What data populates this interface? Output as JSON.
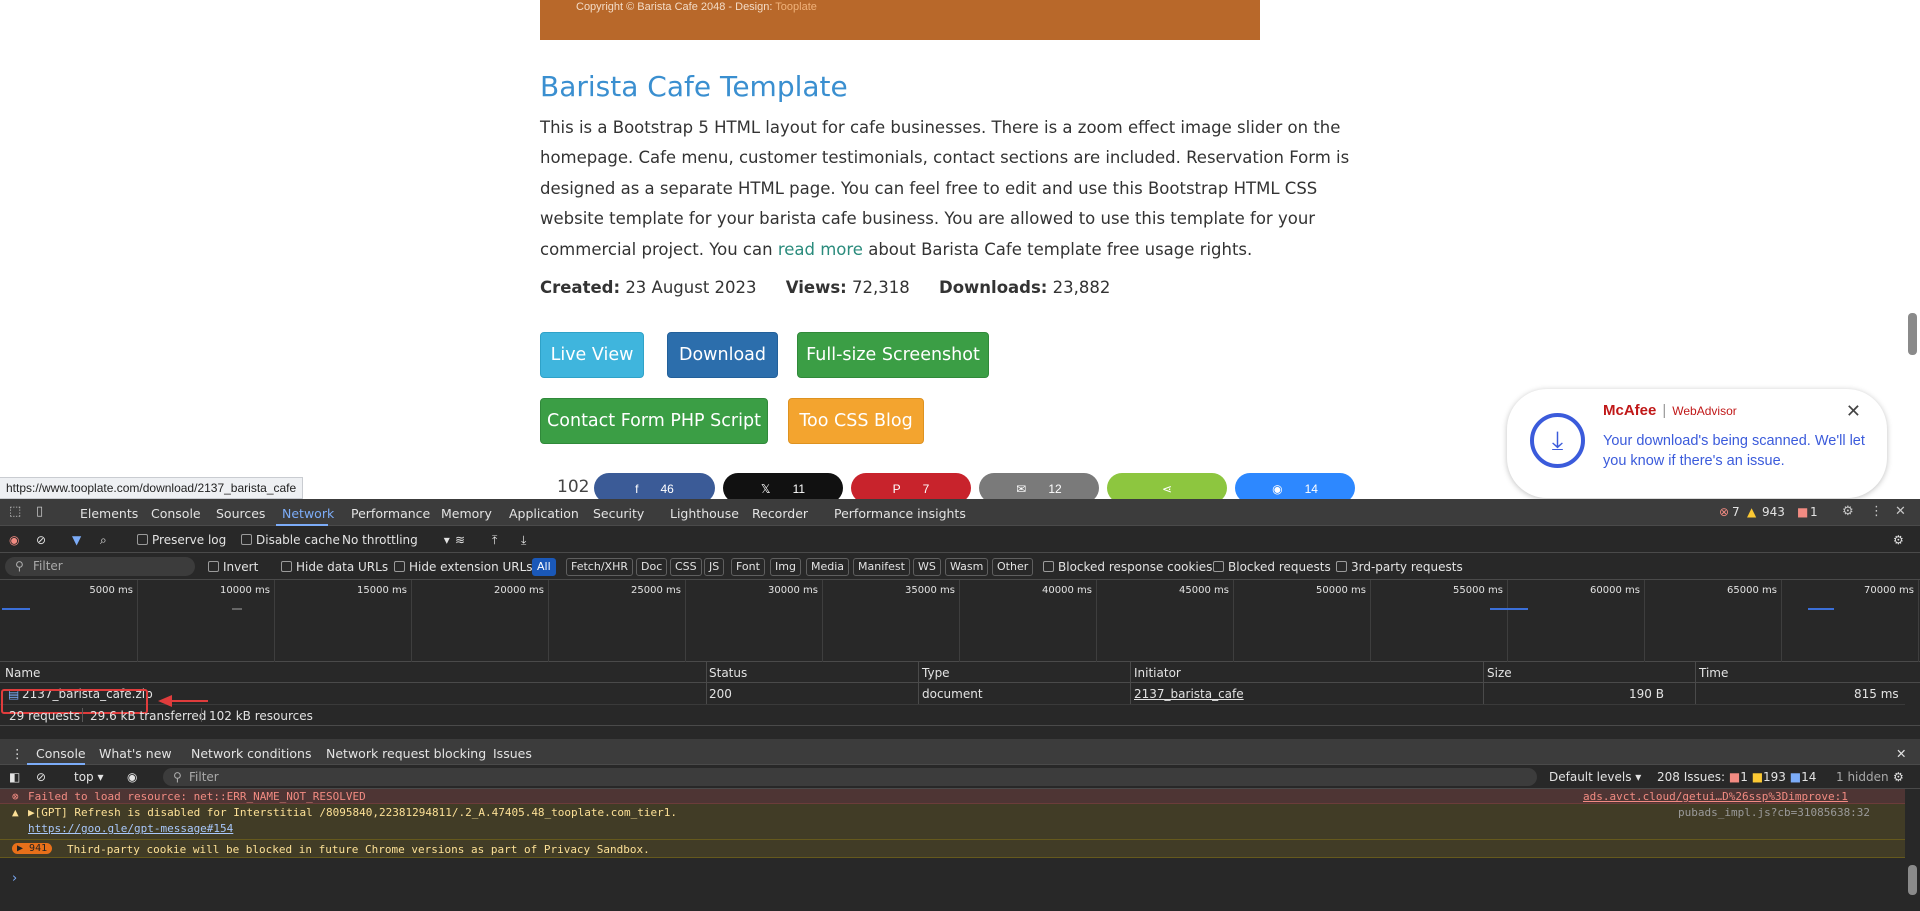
{
  "page": {
    "footer_copyright": "Copyright © Barista Cafe 2048 - Design: ",
    "footer_design_link": "Tooplate",
    "title": "Barista Cafe Template",
    "desc_part1": "This is a Bootstrap 5 HTML layout for cafe businesses. There is a zoom effect image slider on the homepage. Cafe menu, customer testimonials, contact sections are included. Reservation Form is designed as a separate HTML page. You can feel free to edit and use this Bootstrap HTML CSS website template for your barista cafe business. You are allowed to use this template for your commercial project. You can ",
    "desc_link": "read more",
    "desc_part2": " about Barista Cafe template free usage rights.",
    "created_label": "Created:",
    "created_value": "23 August 2023",
    "views_label": "Views:",
    "views_value": "72,318",
    "downloads_label": "Downloads:",
    "downloads_value": "23,882",
    "buttons": {
      "live_view": "Live View",
      "download": "Download",
      "screenshot": "Full-size Screenshot",
      "php": "Contact Form PHP Script",
      "blog": "Too CSS Blog"
    },
    "share_total": "102",
    "shares": [
      {
        "icon": "facebook-icon",
        "glyph": "f",
        "count": "46"
      },
      {
        "icon": "x-icon",
        "glyph": "𝕏",
        "count": "11"
      },
      {
        "icon": "pinterest-icon",
        "glyph": "P",
        "count": "7"
      },
      {
        "icon": "email-icon",
        "glyph": "✉",
        "count": "12"
      },
      {
        "icon": "share-icon",
        "glyph": "⋖",
        "count": ""
      },
      {
        "icon": "messenger-icon",
        "glyph": "◉",
        "count": "14"
      }
    ],
    "status_url": "https://www.tooplate.com/download/2137_barista_cafe"
  },
  "mcafee": {
    "brand": "McAfee",
    "product": "WebAdvisor",
    "message": "Your download's being scanned. We'll let you know if there's an issue."
  },
  "devtools": {
    "tabs": [
      "Elements",
      "Console",
      "Sources",
      "Network",
      "Performance",
      "Memory",
      "Application",
      "Security",
      "Lighthouse",
      "Recorder",
      "Performance insights"
    ],
    "active_tab": "Network",
    "errors": "7",
    "warnings": "943",
    "issues": "1",
    "toolbar": {
      "preserve_log": "Preserve log",
      "disable_cache": "Disable cache",
      "throttling": "No throttling"
    },
    "filter": {
      "placeholder": "Filter",
      "invert": "Invert",
      "hide_data_urls": "Hide data URLs",
      "hide_ext_urls": "Hide extension URLs",
      "types": [
        "All",
        "Fetch/XHR",
        "Doc",
        "CSS",
        "JS",
        "Font",
        "Img",
        "Media",
        "Manifest",
        "WS",
        "Wasm",
        "Other"
      ],
      "blocked_cookies": "Blocked response cookies",
      "blocked_requests": "Blocked requests",
      "third_party": "3rd-party requests"
    },
    "timeline_ticks": [
      "5000 ms",
      "10000 ms",
      "15000 ms",
      "20000 ms",
      "25000 ms",
      "30000 ms",
      "35000 ms",
      "40000 ms",
      "45000 ms",
      "50000 ms",
      "55000 ms",
      "60000 ms",
      "65000 ms",
      "70000 ms"
    ],
    "table": {
      "headers": [
        "Name",
        "Status",
        "Type",
        "Initiator",
        "Size",
        "Time"
      ],
      "row": {
        "name": "2137_barista_cafe.zip",
        "status": "200",
        "type": "document",
        "initiator": "2137_barista_cafe",
        "size": "190 B",
        "time": "815 ms"
      }
    },
    "summary": {
      "requests": "29 requests",
      "transferred": "29.6 kB transferred",
      "resources": "102 kB resources"
    },
    "drawer_tabs": [
      "Console",
      "What's new",
      "Network conditions",
      "Network request blocking",
      "Issues"
    ],
    "console": {
      "context": "top",
      "filter_placeholder": "Filter",
      "levels": "Default levels",
      "issues_label": "208 Issues:",
      "issue_err": "1",
      "issue_warn": "193",
      "issue_info": "14",
      "hidden": "1 hidden",
      "messages": {
        "error_text": "Failed to load resource: net::ERR_NAME_NOT_RESOLVED",
        "error_source": "ads.avct.cloud/getui…D%26ssp%3Dimprove:1",
        "warn_text": "▶[GPT] Refresh is disabled for Interstitial /8095840,22381294811/.2_A.47405.48_tooplate.com_tier1.",
        "warn_link": "https://goo.gle/gpt-message#154",
        "warn_source": "pubads_impl.js?cb=31085638:32",
        "cookie_count": "941",
        "cookie_text": "Third-party cookie will be blocked in future Chrome versions as part of Privacy Sandbox."
      }
    }
  }
}
